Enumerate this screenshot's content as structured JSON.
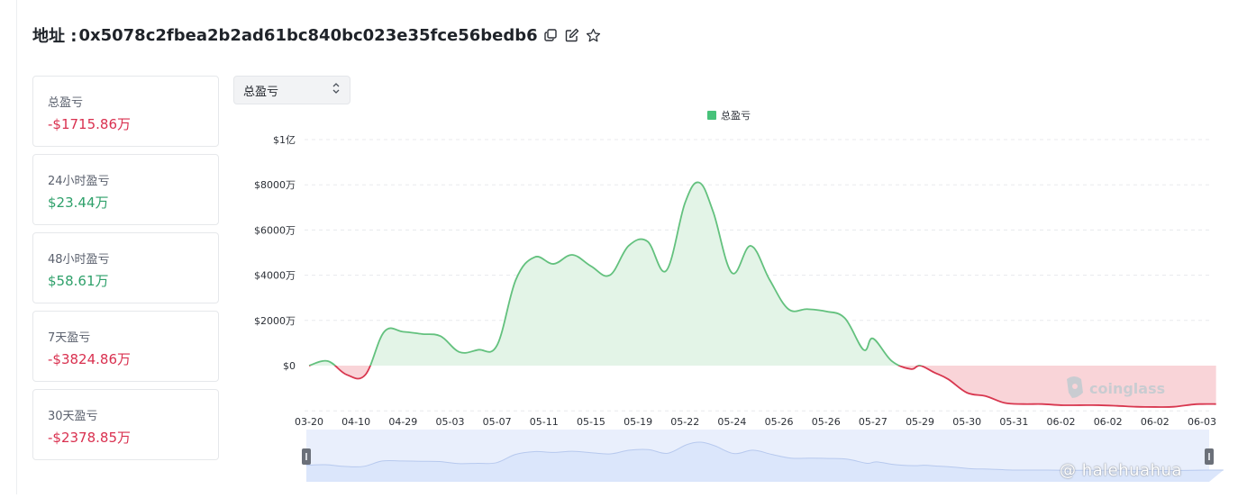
{
  "header": {
    "label": "地址 : ",
    "address": "0x5078c2fbea2b2ad61bc840bc023e35fce56bedb6"
  },
  "icons": {
    "copy": "copy-icon",
    "edit": "edit-icon",
    "star": "star-icon"
  },
  "stats": [
    {
      "label": "总盈亏",
      "value": "-$1715.86万",
      "sign": "neg"
    },
    {
      "label": "24小时盈亏",
      "value": "$23.44万",
      "sign": "pos"
    },
    {
      "label": "48小时盈亏",
      "value": "$58.61万",
      "sign": "pos"
    },
    {
      "label": "7天盈亏",
      "value": "-$3824.86万",
      "sign": "neg"
    },
    {
      "label": "30天盈亏",
      "value": "-$2378.85万",
      "sign": "neg"
    }
  ],
  "selector": {
    "value": "总盈亏"
  },
  "watermark": "coinglass",
  "credit": "@ halehuahua",
  "colors": {
    "positive_line": "#63c17e",
    "positive_fill": "#e3f4e7",
    "negative_line": "#d8374f",
    "negative_fill": "#f9d4d8",
    "minimap_fill": "#dbe6fb",
    "minimap_line": "#b7c9ee"
  },
  "chart_data": {
    "type": "area",
    "legend": [
      "总盈亏"
    ],
    "legend_position": "top-center",
    "y_tick_labels": [
      "$0",
      "$2000万",
      "$4000万",
      "$6000万",
      "$8000万",
      "$1亿"
    ],
    "y_unit": "万",
    "ylim": [
      -2000,
      10000
    ],
    "grid": true,
    "x_tick_labels": [
      "03-20",
      "04-10",
      "04-29",
      "05-03",
      "05-07",
      "05-11",
      "05-15",
      "05-19",
      "05-22",
      "05-24",
      "05-26",
      "05-26",
      "05-27",
      "05-29",
      "05-30",
      "05-31",
      "06-02",
      "06-02",
      "06-02",
      "06-03"
    ],
    "series": [
      {
        "name": "总盈亏",
        "x": [
          0,
          0.4,
          0.8,
          1.2,
          1.6,
          2,
          2.4,
          2.8,
          3.2,
          3.6,
          4,
          4.4,
          4.8,
          5.2,
          5.6,
          6,
          6.4,
          6.8,
          7.2,
          7.6,
          8,
          8.3,
          8.6,
          9,
          9.4,
          9.8,
          10.2,
          10.6,
          11,
          11.4,
          11.8,
          12,
          12.4,
          12.8,
          13,
          13.3,
          13.6,
          14,
          14.4,
          14.8,
          15.2,
          15.6,
          16,
          16.4,
          16.8,
          17.2,
          17.6,
          18,
          18.4,
          18.8,
          19,
          19.3
        ],
        "values": [
          0,
          200,
          -400,
          -400,
          1500,
          1500,
          1400,
          1300,
          600,
          700,
          900,
          3800,
          4800,
          4500,
          4900,
          4400,
          4000,
          5300,
          5500,
          4200,
          7200,
          8100,
          6800,
          4100,
          5300,
          3800,
          2500,
          2500,
          2400,
          2100,
          700,
          1200,
          200,
          -150,
          0,
          -300,
          -600,
          -1200,
          -1350,
          -1650,
          -1700,
          -1700,
          -1750,
          -1750,
          -1750,
          -1780,
          -1820,
          -1830,
          -1820,
          -1720,
          -1700,
          -1700
        ]
      }
    ]
  }
}
